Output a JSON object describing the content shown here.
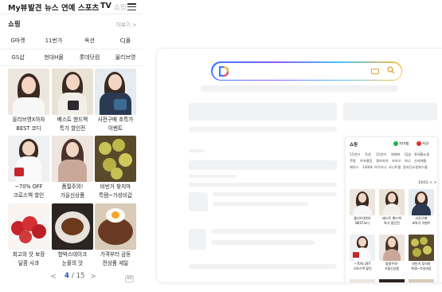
{
  "topnav": {
    "tabs": [
      "My뷰",
      "발견",
      "뉴스",
      "연예",
      "스포츠",
      "TV",
      "쇼핑"
    ]
  },
  "shopping": {
    "title": "쇼핑",
    "more": "더보기 >",
    "chips": [
      "G마켓",
      "11번가",
      "옥션",
      "CJ몰",
      "GS샵",
      "현대H몰",
      "롯데닷컴",
      "올리브영"
    ],
    "products": [
      {
        "line1": "올리브영X아자",
        "line2": "BEST 코디"
      },
      {
        "line1": "베스트 핸드백",
        "line2": "특가 할인전"
      },
      {
        "line1": "사전구매 초특가",
        "line2": "이벤트"
      },
      {
        "line1": "~70% OFF",
        "line2": "크로스백 할인"
      },
      {
        "line1": "품절주의!",
        "line2": "가을신상품"
      },
      {
        "line1": "비빈거 찾지마",
        "line2": "특템~가성비갑"
      },
      {
        "line1": "최고의 맛 보장",
        "line2": "달콤 사과"
      },
      {
        "line1": "함박스테이크",
        "line2": "눈물의 맛"
      },
      {
        "line1": "가격부터 감동",
        "line2": "전상품 세일"
      }
    ],
    "pager": {
      "prev": "<",
      "current": "4",
      "total": "/ 15",
      "next": ">"
    },
    "ad": "AD"
  },
  "preview": {
    "mini": {
      "title": "쇼핑",
      "brand1": "지마켓",
      "brand2": "옥션",
      "chips_row1": [
        "11번가",
        "옥션",
        "11번가",
        "위메프",
        "CJ샵",
        "롯데홈쇼핑"
      ],
      "chips_row2": [
        "쿠팡",
        "하프클럽",
        "갤러리아",
        "카카오",
        "마니",
        "신세계몰"
      ],
      "chips_row3": [
        "헤지스",
        "1300k",
        "아이오나",
        "오니트몰",
        "알라딘쇼핑위스몰"
      ],
      "page": "10/15 <  >",
      "products": [
        {
          "line1": "올리브영X아",
          "line2": "BEST코디"
        },
        {
          "line1": "베스트 핸드백",
          "line2": "특가 할인전"
        },
        {
          "line1": "사전구매",
          "line2": "초특가 이벤트"
        },
        {
          "line1": "~70% OFF",
          "line2": "크로스백 할인"
        },
        {
          "line1": "품절주의!",
          "line2": "가을신상품"
        },
        {
          "line1": "비빈거 찾지마",
          "line2": "특템~가성비갑"
        }
      ]
    }
  },
  "colors": {
    "accent_blue": "#1a55c8",
    "gmarket_green": "#21b14b",
    "auction_red": "#e4322b"
  }
}
